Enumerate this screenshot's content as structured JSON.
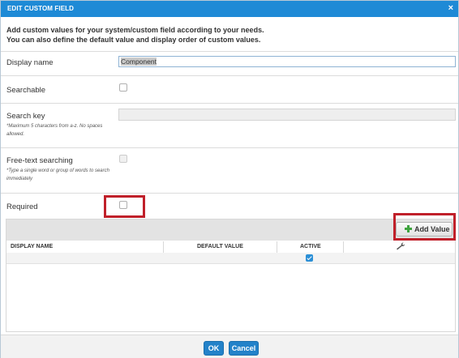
{
  "dialog": {
    "title": "EDIT CUSTOM FIELD",
    "close_glyph": "×",
    "intro_line1": "Add custom values for your system/custom field according to your needs.",
    "intro_line2": "You can also define the default value and display order of custom values."
  },
  "form": {
    "display_name": {
      "label": "Display name",
      "value": "Component"
    },
    "searchable": {
      "label": "Searchable",
      "checked": false
    },
    "search_key": {
      "label": "Search key",
      "hint_line1": "*Maximum 5 characters from a-z. No spaces",
      "hint_line2": "allowed.",
      "value": ""
    },
    "free_text": {
      "label": "Free-text searching",
      "hint_line1": "*Type a single word or group of words to search",
      "hint_line2": "immediately",
      "checked": false
    },
    "required": {
      "label": "Required",
      "checked": false
    }
  },
  "grid": {
    "add_value_label": "Add Value",
    "add_icon": "plus-icon",
    "columns": [
      "DISPLAY NAME",
      "DEFAULT VALUE",
      "ACTIVE"
    ],
    "actions_icon": "wrench-icon",
    "rows": [
      {
        "display_name": "",
        "default_value": "",
        "active": true
      }
    ]
  },
  "footer": {
    "ok_label": "OK",
    "cancel_label": "Cancel"
  },
  "colors": {
    "titlebar": "#1e8ad6",
    "primary_button": "#2382c9",
    "highlight_box": "#c0202a",
    "add_icon": "#3fa33f"
  }
}
